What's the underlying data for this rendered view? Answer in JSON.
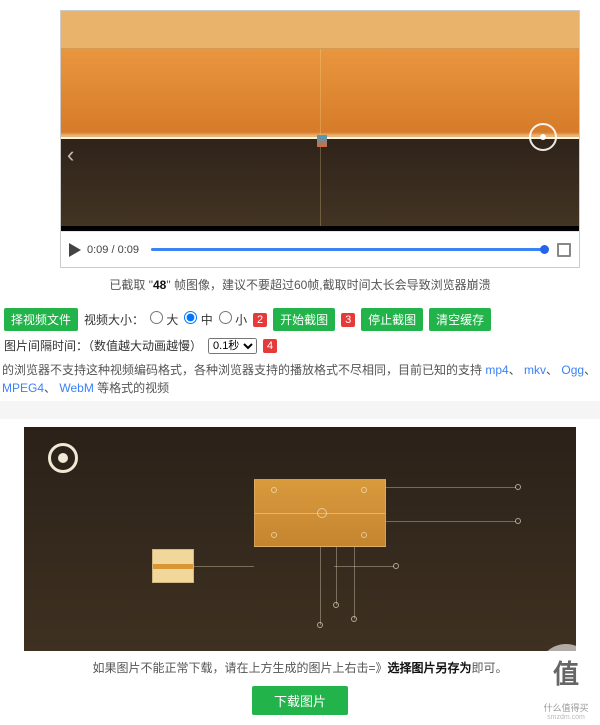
{
  "video": {
    "time_current": "0:09",
    "time_total": "0:09"
  },
  "capture_status": {
    "prefix": "已截取 \"",
    "count": "48",
    "suffix": "\" 帧图像，建议不要超过60帧,截取时间太长会导致浏览器崩溃"
  },
  "options": {
    "choose_file": "择视频文件",
    "size_label": "视频大小：",
    "size_large": "大",
    "size_medium": "中",
    "size_small": "小",
    "start_capture": "开始截图",
    "stop_capture": "停止截图",
    "clear_cache": "清空缓存",
    "interval_label": "图片间隔时间：（数值越大动画越慢）",
    "delay_options": [
      "0.1秒"
    ]
  },
  "badges": {
    "n2": "2",
    "n3": "3",
    "n4": "4"
  },
  "compat_note": {
    "prefix": "的浏览器不支持这种视频编码格式，各种浏览器支持的播放格式不尽相同，目前已知的支持",
    "formats": [
      "mp4",
      "mkv",
      "Ogg",
      "MPEG4",
      "WebM"
    ],
    "suffix": "等格式的视频"
  },
  "download": {
    "hint_prefix": "如果图片不能正常下载，请在上方生成的图片上右击=》",
    "hint_bold": "选择图片另存为",
    "hint_suffix": "即可。",
    "button": "下载图片"
  },
  "watermark": {
    "glyph": "值",
    "line1": "什么值得买",
    "line2": "smzdm.com"
  }
}
